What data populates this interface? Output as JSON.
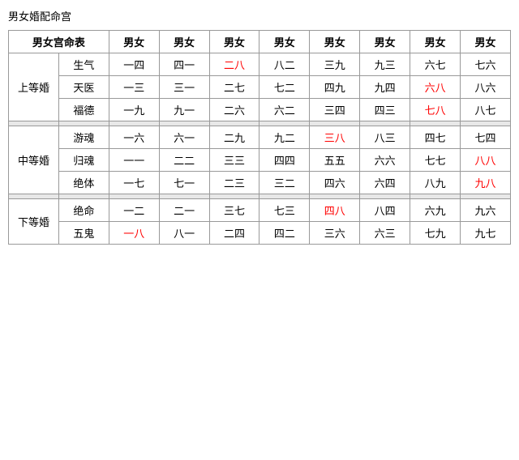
{
  "title": "男女婚配命宫",
  "table": {
    "header_row1_label": "男女宫命表",
    "columns": [
      "男女",
      "男女",
      "男女",
      "男女",
      "男女",
      "男女",
      "男女",
      "男女"
    ],
    "groups": [
      {
        "group_name": "上等婚",
        "rows": [
          {
            "sub_label": "生气",
            "cells": [
              {
                "text": "一四",
                "red": false
              },
              {
                "text": "四一",
                "red": false
              },
              {
                "text": "二八",
                "red": true
              },
              {
                "text": "八二",
                "red": false
              },
              {
                "text": "三九",
                "red": false
              },
              {
                "text": "九三",
                "red": false
              },
              {
                "text": "六七",
                "red": false
              },
              {
                "text": "七六",
                "red": false
              }
            ]
          },
          {
            "sub_label": "天医",
            "cells": [
              {
                "text": "一三",
                "red": false
              },
              {
                "text": "三一",
                "red": false
              },
              {
                "text": "二七",
                "red": false
              },
              {
                "text": "七二",
                "red": false
              },
              {
                "text": "四九",
                "red": false
              },
              {
                "text": "九四",
                "red": false
              },
              {
                "text": "六八",
                "red": true
              },
              {
                "text": "八六",
                "red": false
              }
            ]
          },
          {
            "sub_label": "福德",
            "cells": [
              {
                "text": "一九",
                "red": false
              },
              {
                "text": "九一",
                "red": false
              },
              {
                "text": "二六",
                "red": false
              },
              {
                "text": "六二",
                "red": false
              },
              {
                "text": "三四",
                "red": false
              },
              {
                "text": "四三",
                "red": false
              },
              {
                "text": "七八",
                "red": true
              },
              {
                "text": "八七",
                "red": false
              }
            ]
          }
        ]
      },
      {
        "group_name": "中等婚",
        "rows": [
          {
            "sub_label": "游魂",
            "cells": [
              {
                "text": "一六",
                "red": false
              },
              {
                "text": "六一",
                "red": false
              },
              {
                "text": "二九",
                "red": false
              },
              {
                "text": "九二",
                "red": false
              },
              {
                "text": "三八",
                "red": true
              },
              {
                "text": "八三",
                "red": false
              },
              {
                "text": "四七",
                "red": false
              },
              {
                "text": "七四",
                "red": false
              }
            ]
          },
          {
            "sub_label": "归魂",
            "cells": [
              {
                "text": "一一",
                "red": false
              },
              {
                "text": "二二",
                "red": false
              },
              {
                "text": "三三",
                "red": false
              },
              {
                "text": "四四",
                "red": false
              },
              {
                "text": "五五",
                "red": false
              },
              {
                "text": "六六",
                "red": false
              },
              {
                "text": "七七",
                "red": false
              },
              {
                "text": "八八",
                "red": true
              }
            ]
          },
          {
            "sub_label": "绝体",
            "cells": [
              {
                "text": "一七",
                "red": false
              },
              {
                "text": "七一",
                "red": false
              },
              {
                "text": "二三",
                "red": false
              },
              {
                "text": "三二",
                "red": false
              },
              {
                "text": "四六",
                "red": false
              },
              {
                "text": "六四",
                "red": false
              },
              {
                "text": "八九",
                "red": false
              },
              {
                "text": "九八",
                "red": true
              }
            ]
          }
        ]
      },
      {
        "group_name": "下等婚",
        "rows": [
          {
            "sub_label": "绝命",
            "cells": [
              {
                "text": "一二",
                "red": false
              },
              {
                "text": "二一",
                "red": false
              },
              {
                "text": "三七",
                "red": false
              },
              {
                "text": "七三",
                "red": false
              },
              {
                "text": "四八",
                "red": true
              },
              {
                "text": "八四",
                "red": false
              },
              {
                "text": "六九",
                "red": false
              },
              {
                "text": "九六",
                "red": false
              }
            ]
          },
          {
            "sub_label": "五鬼",
            "cells": [
              {
                "text": "一八",
                "red": true
              },
              {
                "text": "八一",
                "red": false
              },
              {
                "text": "二四",
                "red": false
              },
              {
                "text": "四二",
                "red": false
              },
              {
                "text": "三六",
                "red": false
              },
              {
                "text": "六三",
                "red": false
              },
              {
                "text": "七九",
                "red": false
              },
              {
                "text": "九七",
                "red": false
              }
            ]
          }
        ]
      }
    ]
  }
}
